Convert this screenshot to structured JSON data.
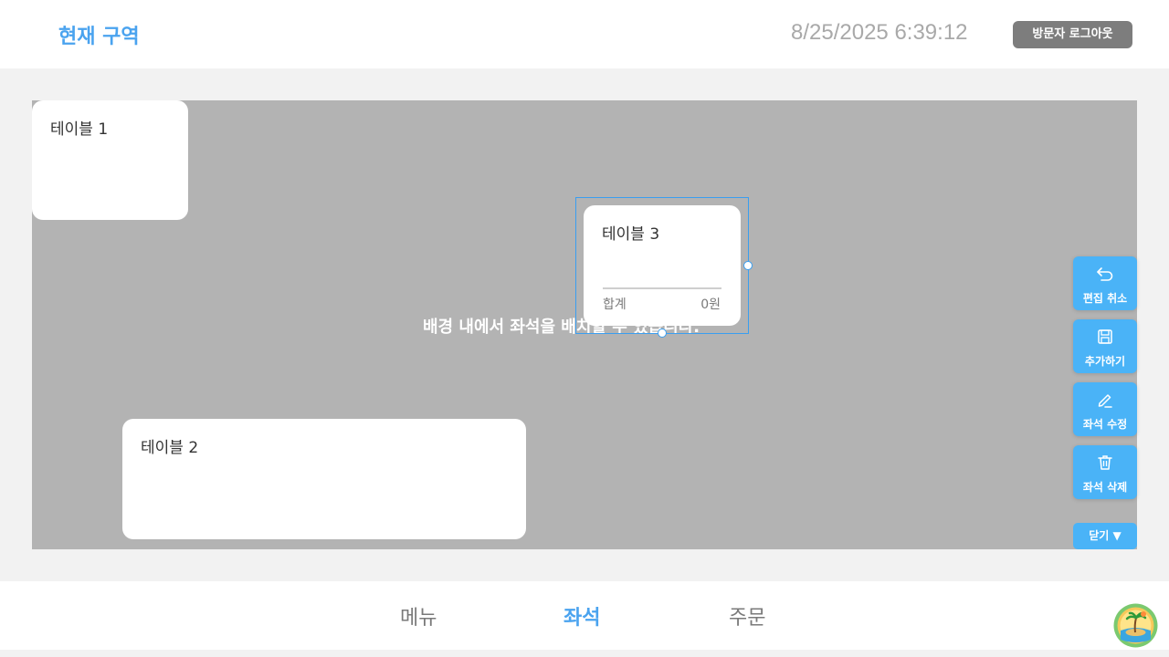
{
  "header": {
    "zone_title": "현재 구역",
    "datetime": "8/25/2025 6:39:12",
    "logout_label": "방문자 로그아웃"
  },
  "canvas": {
    "hint": "배경 내에서 좌석을 배치할 수 있습니다.",
    "tables": [
      {
        "name": "테이블 1"
      },
      {
        "name": "테이블 2"
      },
      {
        "name": "테이블 3",
        "total_label": "합계",
        "total_value": "0원",
        "selected": true
      }
    ]
  },
  "side_actions": {
    "undo_label": "편집 취소",
    "add_label": "추가하기",
    "edit_label": "좌석 수정",
    "delete_label": "좌석 삭제",
    "close_label": "닫기 ▼"
  },
  "bottom_nav": {
    "tabs": [
      {
        "label": "메뉴",
        "active": false
      },
      {
        "label": "좌석",
        "active": true
      },
      {
        "label": "주문",
        "active": false
      }
    ]
  },
  "colors": {
    "accent": "#4aa3ef",
    "action_button": "#4ab3f7",
    "canvas_bg": "#b3b3b3",
    "logout_bg": "#7d7d7d"
  },
  "icons": [
    "undo-icon",
    "save-icon",
    "pencil-icon",
    "trash-icon",
    "avatar-island-icon"
  ]
}
